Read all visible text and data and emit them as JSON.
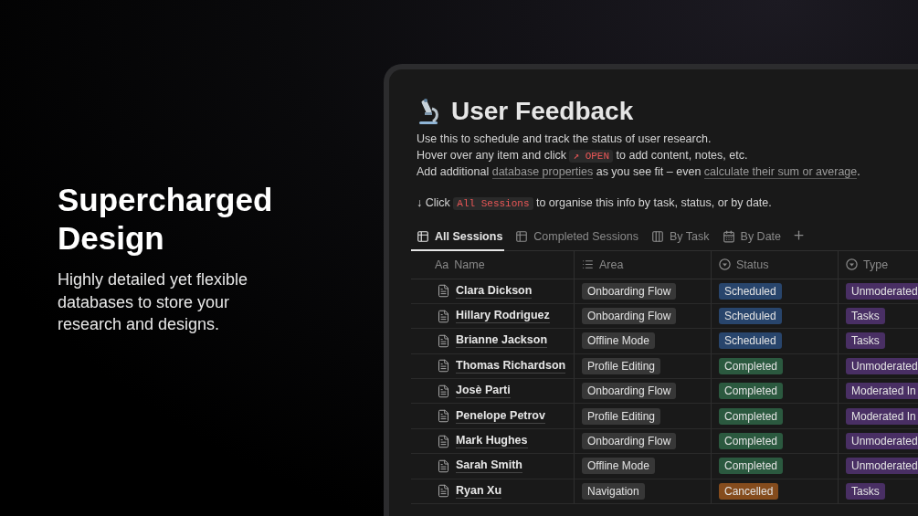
{
  "promo": {
    "heading": "Supercharged Design",
    "text": "Highly detailed yet flexible databases to store your research and designs."
  },
  "page": {
    "title": "User Feedback",
    "description": [
      [
        {
          "kind": "text",
          "text": "Use this to schedule and track the status of user research."
        }
      ],
      [
        {
          "kind": "text",
          "text": "Hover over any item and click "
        },
        {
          "kind": "code",
          "text": "↗ OPEN"
        },
        {
          "kind": "text",
          "text": " to add content, notes, etc."
        }
      ],
      [
        {
          "kind": "text",
          "text": "Add additional "
        },
        {
          "kind": "link",
          "text": "database properties"
        },
        {
          "kind": "text",
          "text": " as you see fit – even "
        },
        {
          "kind": "link",
          "text": "calculate their sum or average"
        },
        {
          "kind": "text",
          "text": "."
        }
      ]
    ],
    "hint": [
      {
        "kind": "text",
        "text": "↓ Click "
      },
      {
        "kind": "code",
        "text": "All Sessions"
      },
      {
        "kind": "text",
        "text": " to organise this info by task, status, or by date."
      }
    ],
    "tabs": [
      {
        "label": "All Sessions",
        "kind": "table",
        "selected": true
      },
      {
        "label": "Completed Sessions",
        "kind": "table",
        "selected": false
      },
      {
        "label": "By Task",
        "kind": "board",
        "selected": false
      },
      {
        "label": "By Date",
        "kind": "calendar",
        "selected": false
      }
    ],
    "table": {
      "columns": [
        {
          "label": "Name",
          "prefix": "Aa"
        },
        {
          "label": "Area",
          "kind": "list"
        },
        {
          "label": "Status",
          "kind": "select"
        },
        {
          "label": "Type",
          "kind": "select"
        }
      ],
      "rows": [
        {
          "name": "Clara Dickson",
          "area": {
            "label": "Onboarding Flow",
            "color": "#373737"
          },
          "status": {
            "label": "Scheduled",
            "color": "#28456c"
          },
          "type": {
            "label": "Unmoderated",
            "color": "#492f64"
          }
        },
        {
          "name": "Hillary Rodriguez",
          "area": {
            "label": "Onboarding Flow",
            "color": "#373737"
          },
          "status": {
            "label": "Scheduled",
            "color": "#28456c"
          },
          "type": {
            "label": "Tasks",
            "color": "#492f64"
          }
        },
        {
          "name": "Brianne Jackson",
          "area": {
            "label": "Offline Mode",
            "color": "#373737"
          },
          "status": {
            "label": "Scheduled",
            "color": "#28456c"
          },
          "type": {
            "label": "Tasks",
            "color": "#492f64"
          }
        },
        {
          "name": "Thomas Richardson",
          "area": {
            "label": "Profile Editing",
            "color": "#373737"
          },
          "status": {
            "label": "Completed",
            "color": "#2b593f"
          },
          "type": {
            "label": "Unmoderated",
            "color": "#492f64"
          }
        },
        {
          "name": "Josè Parti",
          "area": {
            "label": "Onboarding Flow",
            "color": "#373737"
          },
          "status": {
            "label": "Completed",
            "color": "#2b593f"
          },
          "type": {
            "label": "Moderated In",
            "color": "#492f64"
          }
        },
        {
          "name": "Penelope Petrov",
          "area": {
            "label": "Profile Editing",
            "color": "#373737"
          },
          "status": {
            "label": "Completed",
            "color": "#2b593f"
          },
          "type": {
            "label": "Moderated In",
            "color": "#492f64"
          }
        },
        {
          "name": "Mark Hughes",
          "area": {
            "label": "Onboarding Flow",
            "color": "#373737"
          },
          "status": {
            "label": "Completed",
            "color": "#2b593f"
          },
          "type": {
            "label": "Unmoderated",
            "color": "#492f64"
          }
        },
        {
          "name": "Sarah Smith",
          "area": {
            "label": "Offline Mode",
            "color": "#373737"
          },
          "status": {
            "label": "Completed",
            "color": "#2b593f"
          },
          "type": {
            "label": "Unmoderated",
            "color": "#492f64"
          }
        },
        {
          "name": "Ryan Xu",
          "area": {
            "label": "Navigation",
            "color": "#373737"
          },
          "status": {
            "label": "Cancelled",
            "color": "#854c1d"
          },
          "type": {
            "label": "Tasks",
            "color": "#492f64"
          }
        }
      ]
    }
  }
}
